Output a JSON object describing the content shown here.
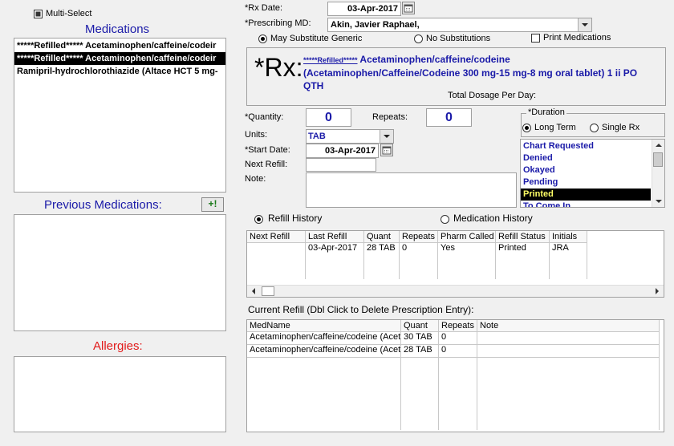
{
  "multi_select": {
    "label": "Multi-Select",
    "checked": true
  },
  "medications": {
    "title": "Medications",
    "items": [
      {
        "label": "*****Refilled*****  Acetaminophen/caffeine/codeir",
        "selected": false
      },
      {
        "label": "*****Refilled*****  Acetaminophen/caffeine/codeir",
        "selected": true
      },
      {
        "label": "Ramipril-hydrochlorothiazide (Altace HCT 5 mg-",
        "selected": false
      }
    ]
  },
  "previous_medications": {
    "title": "Previous Medications:",
    "add_button_label": "+!"
  },
  "allergies": {
    "title": "Allergies:"
  },
  "rx_date": {
    "label": "*Rx Date:",
    "value": "03-Apr-2017"
  },
  "prescribing_md": {
    "label": "*Prescribing MD:",
    "value": "Akin, Javier Raphael,"
  },
  "substitution": {
    "may_substitute": "May Substitute Generic",
    "no_substitutions": "No Substitutions",
    "print_medications": "Print Medications",
    "selected": "may_substitute"
  },
  "rx": {
    "symbol": "*Rx:",
    "prefix": "*****Refilled*****",
    "text": "Acetaminophen/caffeine/codeine (Acetaminophen/Caffeine/Codeine 300 mg-15 mg-8 mg oral tablet) 1 ii PO  QTH",
    "total_dosage_label": "Total Dosage Per Day:"
  },
  "quantity": {
    "label": "*Quantity:",
    "value": "0"
  },
  "repeats": {
    "label": "Repeats:",
    "value": "0"
  },
  "units": {
    "label": "Units:",
    "value": "TAB"
  },
  "start_date": {
    "label": "*Start Date:",
    "value": "03-Apr-2017"
  },
  "next_refill": {
    "label": "Next Refill:",
    "value": ""
  },
  "note": {
    "label": "Note:",
    "value": ""
  },
  "duration": {
    "label": "*Duration",
    "long_term": "Long Term",
    "single_rx": "Single Rx",
    "selected": "long_term"
  },
  "status_list": {
    "items": [
      "Chart Requested",
      "Denied",
      "Okayed",
      "Pending",
      "Printed",
      "To Come In"
    ],
    "selected_index": 4
  },
  "history_tabs": {
    "refill_history": "Refill History",
    "medication_history": "Medication History",
    "selected": "refill_history"
  },
  "refill_history": {
    "columns": [
      "Next Refill",
      "Last Refill",
      "Quant",
      "Repeats",
      "Pharm Called",
      "Refill Status",
      "Initials"
    ],
    "rows": [
      [
        "",
        "03-Apr-2017",
        "28 TAB",
        "0",
        "Yes",
        "Printed",
        "JRA"
      ]
    ]
  },
  "current_refill": {
    "label": "Current Refill (Dbl Click to Delete Prescription Entry):",
    "columns": [
      "MedName",
      "Quant",
      "Repeats",
      "Note"
    ],
    "rows": [
      [
        "Acetaminophen/caffeine/codeine (Acet",
        "30 TAB",
        "0",
        ""
      ],
      [
        "Acetaminophen/caffeine/codeine (Acet",
        "28 TAB",
        "0",
        ""
      ]
    ]
  },
  "colors": {
    "accent_blue": "#1a1aa8",
    "allergy_red": "#e21a1a",
    "selected_bg": "#000000"
  }
}
